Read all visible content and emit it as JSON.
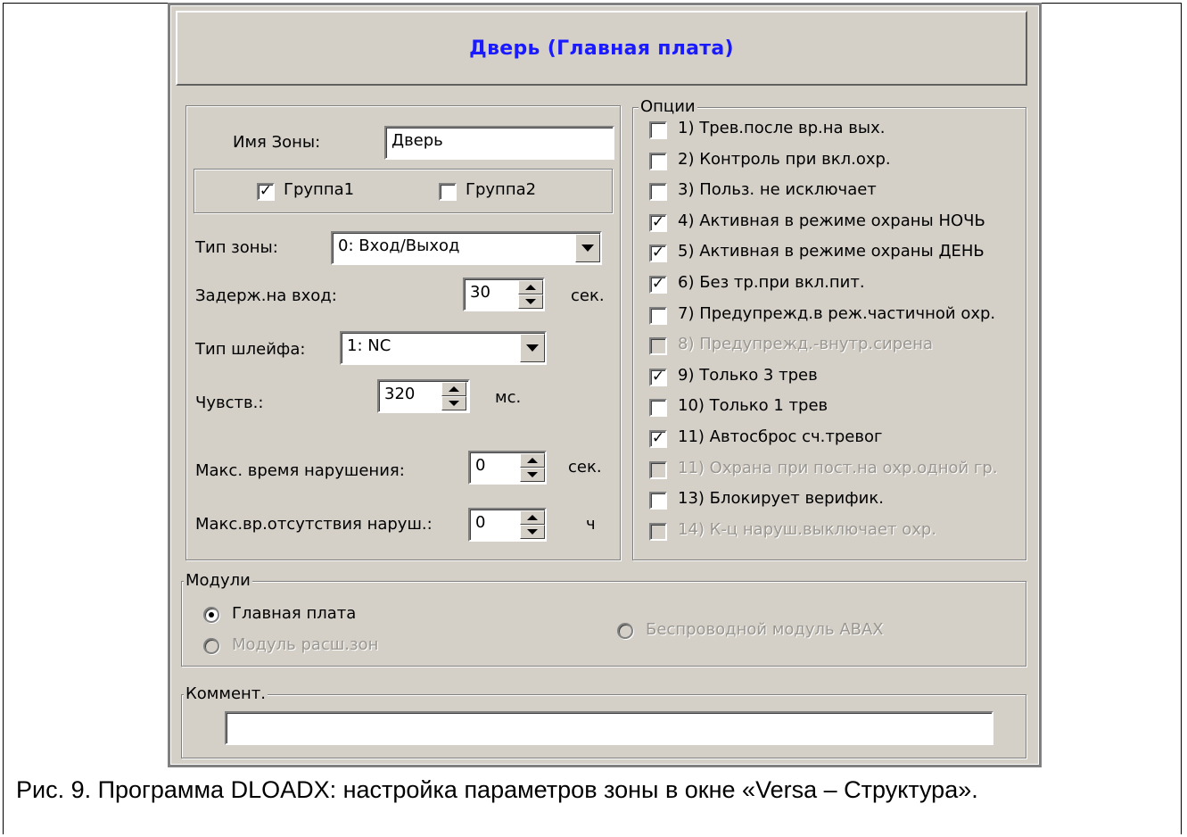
{
  "window": {
    "title": "Дверь (Главная плата)"
  },
  "zone": {
    "name_label": "Имя Зоны:",
    "name_value": "Дверь",
    "groups": [
      {
        "label": "Группа1",
        "checked": true
      },
      {
        "label": "Группа2",
        "checked": false
      }
    ],
    "type_label": "Тип зоны:",
    "type_value": "0: Вход/Выход",
    "entry_delay_label": "Задерж.на вход:",
    "entry_delay_value": "30",
    "entry_delay_unit": "сек.",
    "loop_type_label": "Тип шлейфа:",
    "loop_type_value": "1: NC",
    "sensitivity_label": "Чувств.:",
    "sensitivity_value": "320",
    "sensitivity_unit": "мс.",
    "max_violation_label": "Макс. время нарушения:",
    "max_violation_value": "0",
    "max_violation_unit": "сек.",
    "max_no_violation_label": "Макс.вр.отсутствия наруш.:",
    "max_no_violation_value": "0",
    "max_no_violation_unit": "ч"
  },
  "options": {
    "title": "Опции",
    "items": [
      {
        "label": "1) Трев.после вр.на вых.",
        "checked": false,
        "enabled": true
      },
      {
        "label": "2) Контроль при вкл.охр.",
        "checked": false,
        "enabled": true
      },
      {
        "label": "3) Польз. не исключает",
        "checked": false,
        "enabled": true
      },
      {
        "label": "4) Активная в режиме охраны НОЧЬ",
        "checked": true,
        "enabled": true
      },
      {
        "label": "5) Активная в режиме охраны ДЕНЬ",
        "checked": true,
        "enabled": true
      },
      {
        "label": "6) Без тр.при вкл.пит.",
        "checked": true,
        "enabled": true
      },
      {
        "label": "7) Предупрежд.в реж.частичной охр.",
        "checked": false,
        "enabled": true
      },
      {
        "label": "8) Предупрежд.-внутр.сирена",
        "checked": false,
        "enabled": false
      },
      {
        "label": "9) Только 3 трев",
        "checked": true,
        "enabled": true
      },
      {
        "label": "10) Только 1 трев",
        "checked": false,
        "enabled": true
      },
      {
        "label": "11) Автосброс сч.тревог",
        "checked": true,
        "enabled": true
      },
      {
        "label": "11) Охрана при пост.на охр.одной гр.",
        "checked": false,
        "enabled": false
      },
      {
        "label": "13) Блокирует верифик.",
        "checked": false,
        "enabled": true
      },
      {
        "label": "14) К-ц наруш.выключает охр.",
        "checked": false,
        "enabled": false
      }
    ]
  },
  "modules": {
    "title": "Модули",
    "main_board": {
      "label": "Главная плата",
      "selected": true,
      "enabled": true
    },
    "expander": {
      "label": "Модуль расш.зон",
      "selected": false,
      "enabled": false
    },
    "abax": {
      "label": "Беспроводной модуль ABAX",
      "selected": false,
      "enabled": false
    }
  },
  "comment": {
    "title": "Коммент.",
    "value": ""
  },
  "caption": "Рис. 9. Программа DLOADX: настройка параметров зоны в окне «Versa – Структура»."
}
